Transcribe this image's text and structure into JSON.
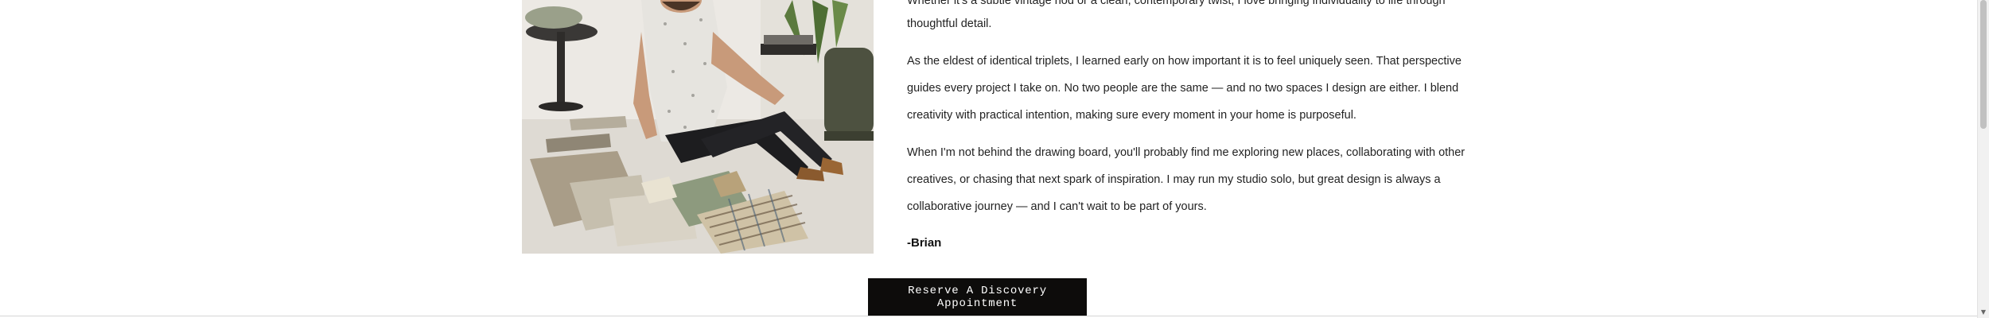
{
  "bio": {
    "line_top": "Whether it's a subtle vintage nod or a clean, contemporary twist, I love bringing individuality to life through",
    "line_1": "thoughtful detail.",
    "line_2": "As the eldest of identical triplets, I learned early on how important it is to feel uniquely seen.  That perspective",
    "line_3": "guides every project I take on.  No two people are the same — and no two spaces I design are either.  I blend",
    "line_4": "creativity with practical intention, making sure every moment in your home is purposeful.",
    "line_5": "When I'm not behind the drawing board, you'll probably find me exploring new places, collaborating with other",
    "line_6": "creatives, or chasing that next spark of inspiration.  I may run my studio solo, but great design is always a",
    "line_7": "collaborative journey — and I can't wait to be part of yours.",
    "signature": "-Brian"
  },
  "photo": {
    "alt_subject": "designer-seated-with-fabric-swatches"
  },
  "cta": {
    "label": "Reserve A Discovery Appointment"
  },
  "colors": {
    "button_bg": "#0d0c0b",
    "button_text": "#ffffff",
    "body_text": "#222222"
  }
}
